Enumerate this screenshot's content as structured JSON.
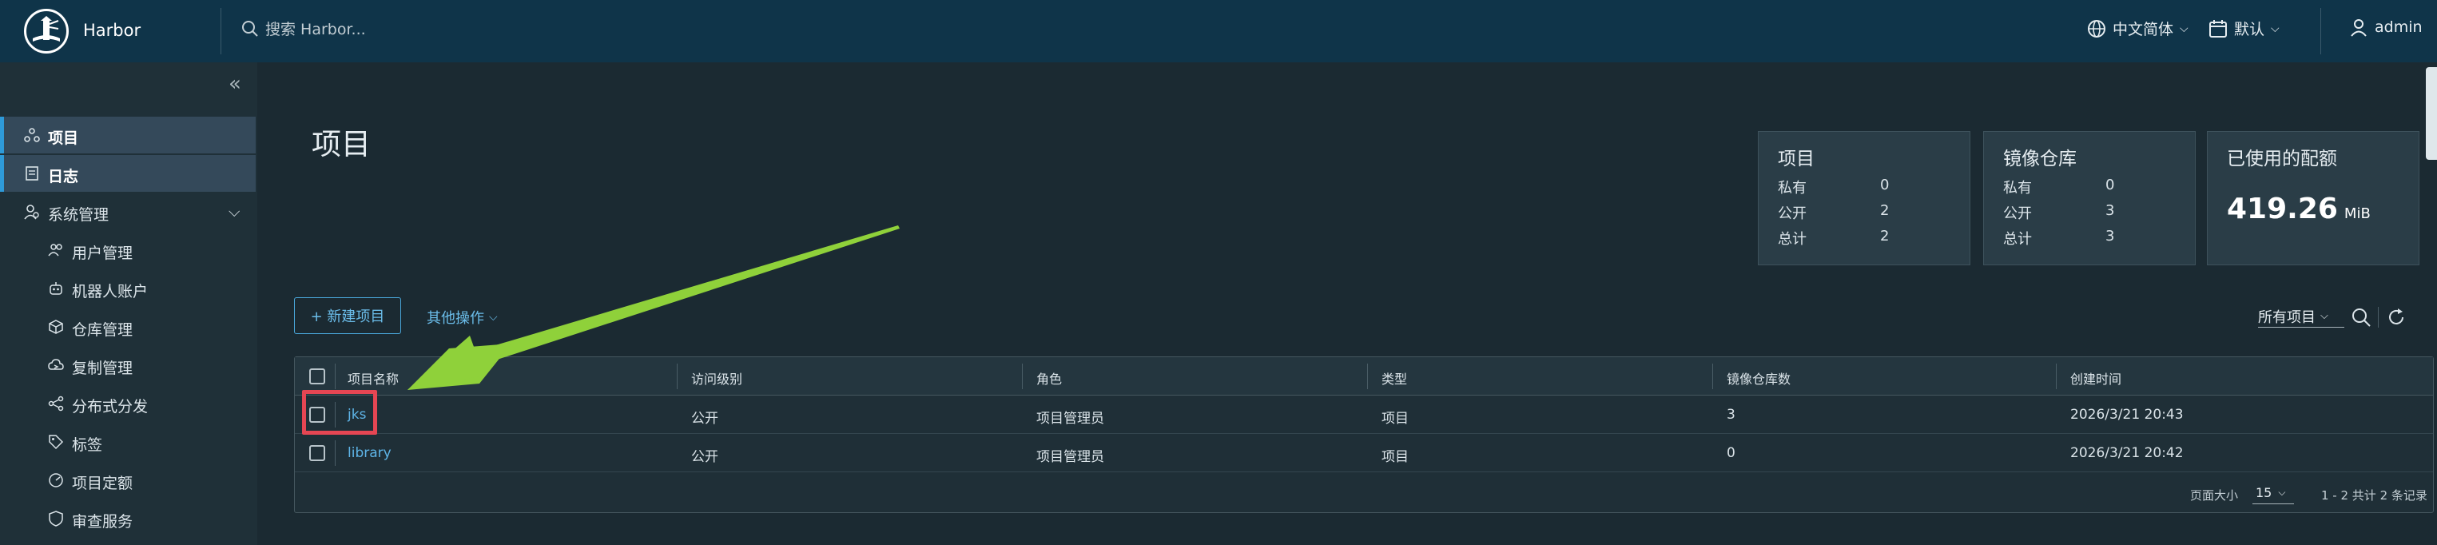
{
  "header": {
    "brand": "Harbor",
    "search_placeholder": "搜索 Harbor...",
    "language": "中文简体",
    "date_format": "默认",
    "user": "admin"
  },
  "sidebar": {
    "items": [
      {
        "label": "项目",
        "icon": "projects-icon"
      },
      {
        "label": "日志",
        "icon": "logs-icon"
      },
      {
        "label": "系统管理",
        "icon": "admin-icon"
      }
    ],
    "sub_items": [
      {
        "label": "用户管理",
        "icon": "users-icon"
      },
      {
        "label": "机器人账户",
        "icon": "robot-icon"
      },
      {
        "label": "仓库管理",
        "icon": "registry-icon"
      },
      {
        "label": "复制管理",
        "icon": "replication-icon"
      },
      {
        "label": "分布式分发",
        "icon": "distribution-icon"
      },
      {
        "label": "标签",
        "icon": "tag-icon"
      },
      {
        "label": "项目定额",
        "icon": "quota-icon"
      },
      {
        "label": "审查服务",
        "icon": "shield-icon"
      }
    ]
  },
  "main": {
    "title": "项目",
    "cards": {
      "projects": {
        "title": "项目",
        "private_label": "私有",
        "private": "0",
        "public_label": "公开",
        "public": "2",
        "total_label": "总计",
        "total": "2"
      },
      "repos": {
        "title": "镜像仓库",
        "private_label": "私有",
        "private": "0",
        "public_label": "公开",
        "public": "3",
        "total_label": "总计",
        "total": "3"
      },
      "quota": {
        "title": "已使用的配额",
        "value": "419.26",
        "unit": "MiB"
      }
    },
    "new_project_label": "+ 新建项目",
    "more_actions_label": "其他操作",
    "filter_label": "所有项目"
  },
  "table": {
    "columns": [
      "项目名称",
      "访问级别",
      "角色",
      "类型",
      "镜像仓库数",
      "创建时间"
    ],
    "rows": [
      {
        "name": "jks",
        "access": "公开",
        "role": "项目管理员",
        "type": "项目",
        "repos": "3",
        "created": "2026/3/21 20:43"
      },
      {
        "name": "library",
        "access": "公开",
        "role": "项目管理员",
        "type": "项目",
        "repos": "0",
        "created": "2026/3/21 20:42"
      }
    ],
    "page_size_label": "页面大小",
    "page_size": "15",
    "summary": "1 - 2 共计 2 条记录"
  },
  "colors": {
    "header_bg": "#0f3449",
    "accent": "#2e9ad8",
    "link": "#5eb5e8",
    "highlight": "#e64653",
    "arrow": "#8fd13a"
  }
}
